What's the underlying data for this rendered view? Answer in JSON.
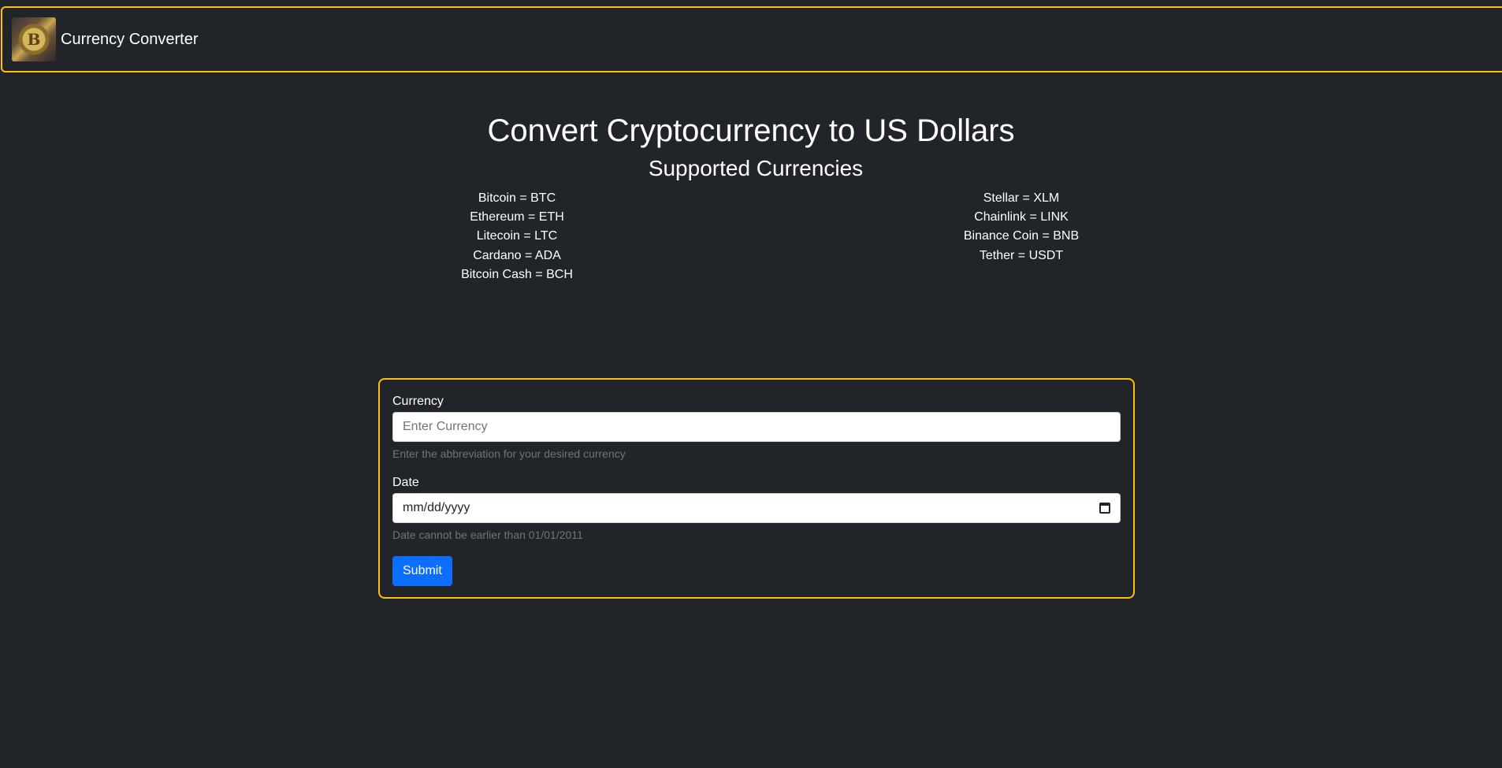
{
  "navbar": {
    "brand": "Currency Converter",
    "logo_icon": "bitcoin-logo-icon",
    "logo_glyph": "B"
  },
  "heading": {
    "title": "Convert Cryptocurrency to US Dollars",
    "subtitle": "Supported Currencies"
  },
  "currencies": {
    "left": [
      "Bitcoin = BTC",
      "Ethereum = ETH",
      "Litecoin = LTC",
      "Cardano = ADA",
      "Bitcoin Cash = BCH"
    ],
    "right": [
      "Stellar = XLM",
      "Chainlink = LINK",
      "Binance Coin = BNB",
      "Tether = USDT"
    ]
  },
  "form": {
    "currency_label": "Currency",
    "currency_placeholder": "Enter Currency",
    "currency_help": "Enter the abbreviation for your desired currency",
    "date_label": "Date",
    "date_value": "mm/dd/yyyy",
    "date_icon": "calendar-icon",
    "date_help": "Date cannot be earlier than 01/01/2011",
    "submit_label": "Submit"
  },
  "colors": {
    "background": "#212529",
    "accent_border": "#ffc107",
    "primary_button": "#0d6efd",
    "muted_text": "#6c757d"
  }
}
